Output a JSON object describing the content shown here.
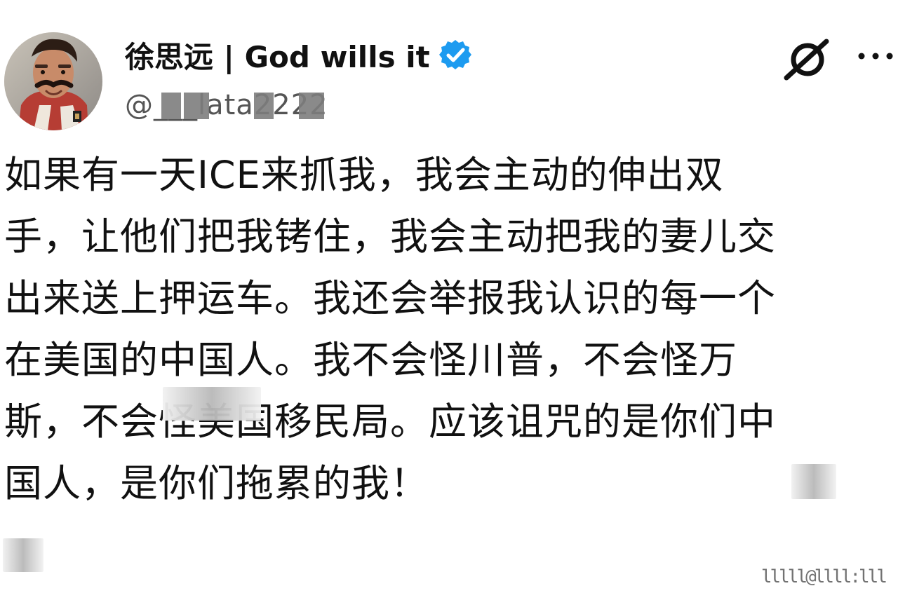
{
  "post": {
    "author": {
      "display_name": "徐思远 | God wills it",
      "handle": "@___lata2222",
      "verified": true,
      "avatar_icon": "profile-photo"
    },
    "actions": {
      "grok_icon": "grok-icon",
      "more_icon": "more-options-icon"
    },
    "body_lines": [
      "如果有一天ICE来抓我，我会主动的伸出双",
      "手，让他们把我铐住，我会主动把我的妻儿交",
      "出来送上押运车。我还会举报我认识的每一个",
      "在美国的中国人。我不会怪川普，不会怪万",
      "斯，不会怪美国移民局。应该诅咒的是你们中",
      "国人，是你们拖累的我！"
    ],
    "watermark": "lllll@llll:lll"
  },
  "colors": {
    "verified_blue": "#1D9BF0",
    "text": "#111111",
    "secondary_text": "#555555",
    "background": "#FFFFFF"
  }
}
